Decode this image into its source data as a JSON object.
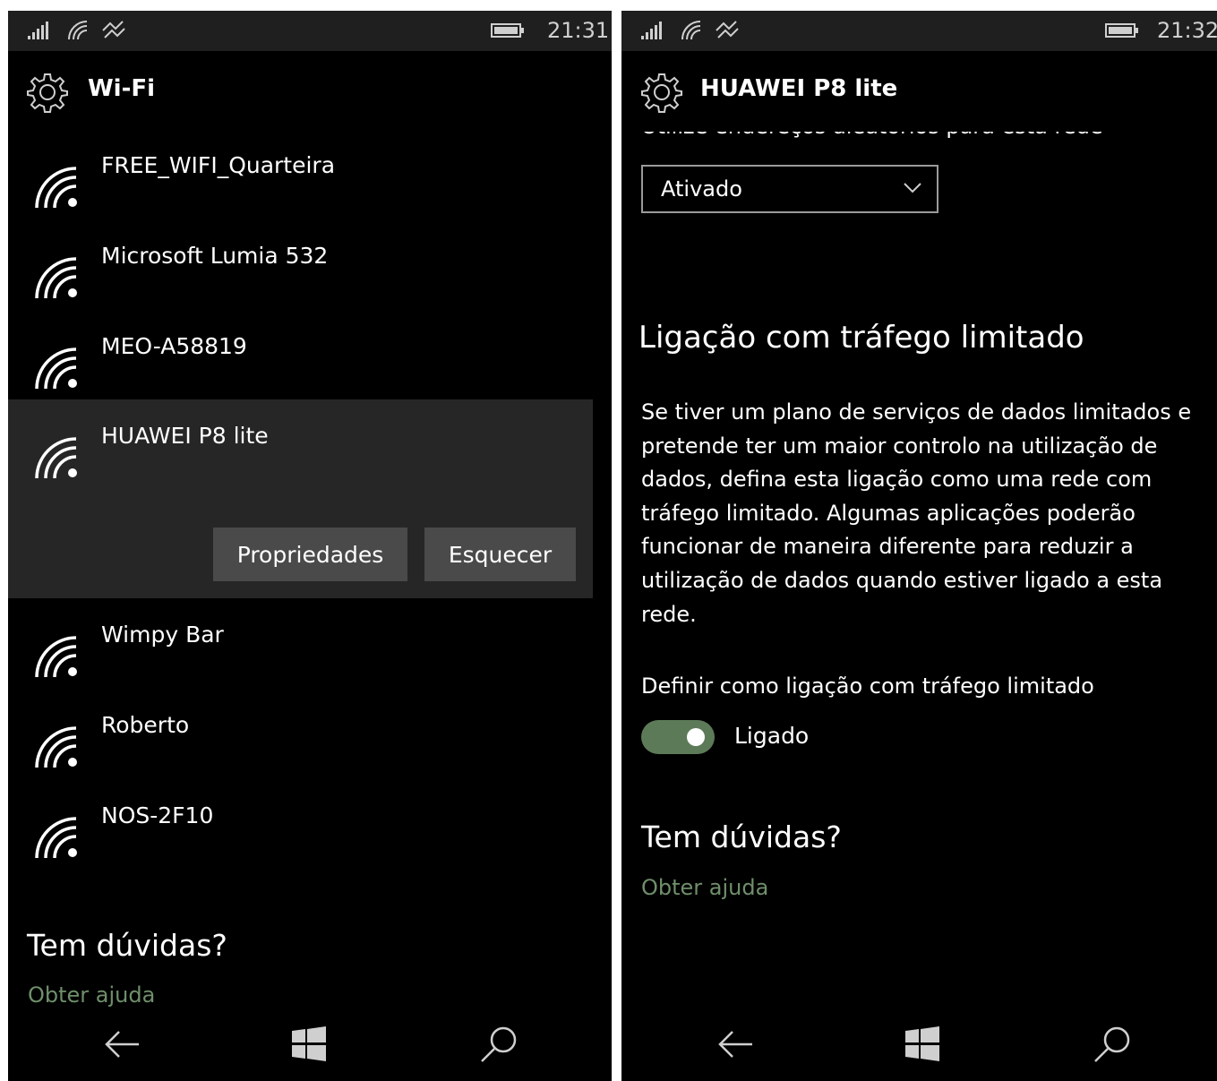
{
  "left": {
    "status": {
      "time": "21:31"
    },
    "header": {
      "title": "Wi-Fi",
      "icon": "gear-icon"
    },
    "networks": [
      {
        "name": "FREE_WIFI_Quarteira"
      },
      {
        "name": "Microsoft Lumia 532"
      },
      {
        "name": "MEO-A58819"
      },
      {
        "name": "HUAWEI P8 lite"
      },
      {
        "name": "Wimpy Bar"
      },
      {
        "name": "Roberto"
      },
      {
        "name": "NOS-2F10"
      }
    ],
    "actions": {
      "properties": "Propriedades",
      "forget": "Esquecer"
    },
    "help": {
      "title": "Tem dúvidas?",
      "link": "Obter ajuda"
    }
  },
  "right": {
    "status": {
      "time": "21:32"
    },
    "header": {
      "title": "HUAWEI P8 lite",
      "icon": "gear-icon"
    },
    "random_address_label": "Utilize endereços aleatórios para esta rede",
    "random_address_value": "Ativado",
    "metered": {
      "title": "Ligação com tráfego limitado",
      "description": "Se tiver um plano de serviços de dados limitados e pretende ter um maior controlo na utilização de dados, defina esta ligação como uma rede com tráfego limitado. Algumas aplicações poderão funcionar de maneira diferente para reduzir a utilização de dados quando estiver ligado a esta rede.",
      "toggle_label": "Definir como ligação com tráfego limitado",
      "toggle_state": "Ligado"
    },
    "help": {
      "title": "Tem dúvidas?",
      "link": "Obter ajuda"
    }
  },
  "colors": {
    "background": "#000000",
    "statusbar": "#1f1f1f",
    "selected_item": "#262626",
    "button": "#4a4a4a",
    "accent": "#5d7a58",
    "link": "#6f8f6b"
  }
}
